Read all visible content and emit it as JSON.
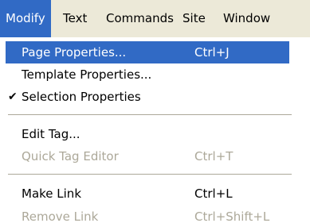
{
  "menubar": {
    "items": [
      {
        "label": "Modify"
      },
      {
        "label": "Text"
      },
      {
        "label": "Commands"
      },
      {
        "label": "Site"
      },
      {
        "label": "Window"
      }
    ]
  },
  "menu": {
    "items": [
      {
        "label": "Page Properties...",
        "shortcut": "Ctrl+J",
        "state": "highlighted"
      },
      {
        "label": "Template Properties...",
        "shortcut": "",
        "state": "normal"
      },
      {
        "label": "Selection Properties",
        "shortcut": "",
        "state": "checked"
      },
      {
        "label": "Edit Tag...",
        "shortcut": "",
        "state": "normal"
      },
      {
        "label": "Quick Tag Editor",
        "shortcut": "Ctrl+T",
        "state": "disabled"
      },
      {
        "label": "Make Link",
        "shortcut": "Ctrl+L",
        "state": "normal"
      },
      {
        "label": "Remove Link",
        "shortcut": "Ctrl+Shift+L",
        "state": "disabled"
      }
    ],
    "checkmark": "✔"
  },
  "colors": {
    "highlight": "#316ac5",
    "menubar_bg": "#ece9d8",
    "disabled_text": "#aca899"
  }
}
